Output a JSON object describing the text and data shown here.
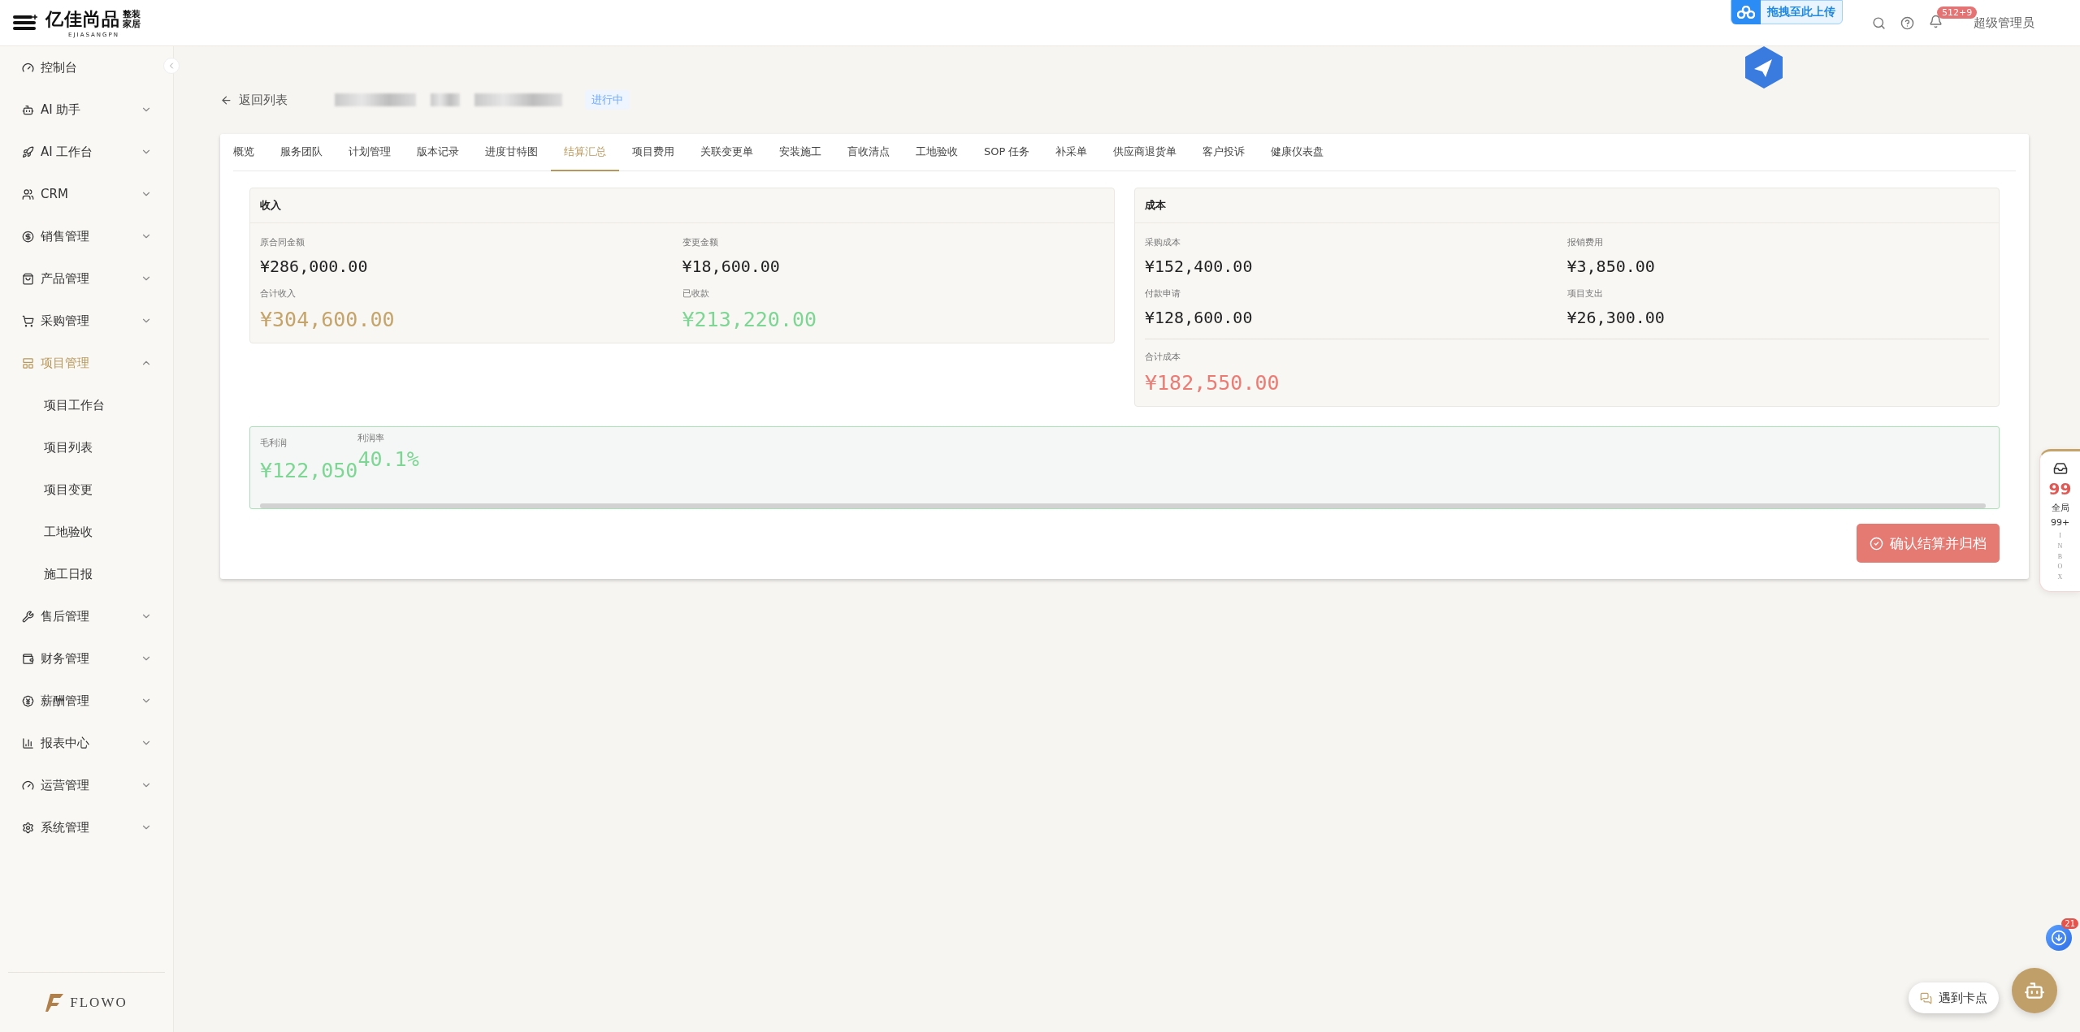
{
  "header": {
    "logo": {
      "name": "亿佳尚品",
      "tag": "整装家居",
      "sub": "EJIASANGPN"
    },
    "upload_hint": "拖拽至此上传",
    "notification_count": "512+9",
    "user": "超级管理员"
  },
  "sidebar": {
    "items": [
      {
        "label": "控制台",
        "selected": false
      },
      {
        "label": "AI 助手",
        "expanded": false,
        "selected": false
      },
      {
        "label": "AI 工作台",
        "expanded": false,
        "selected": false
      },
      {
        "label": "CRM",
        "expanded": false,
        "selected": false
      },
      {
        "label": "销售管理",
        "expanded": false,
        "selected": false
      },
      {
        "label": "产品管理",
        "expanded": false,
        "selected": false
      },
      {
        "label": "采购管理",
        "expanded": false,
        "selected": false
      },
      {
        "label": "项目管理",
        "expanded": true,
        "selected": true,
        "children": [
          {
            "label": "项目工作台",
            "selected": false
          },
          {
            "label": "项目列表",
            "selected": false
          },
          {
            "label": "项目变更",
            "selected": false
          },
          {
            "label": "工地验收",
            "selected": false
          },
          {
            "label": "施工日报",
            "selected": false
          }
        ]
      },
      {
        "label": "售后管理",
        "expanded": false,
        "selected": false
      },
      {
        "label": "财务管理",
        "expanded": false,
        "selected": false
      },
      {
        "label": "薪酬管理",
        "expanded": false,
        "selected": false
      },
      {
        "label": "报表中心",
        "expanded": false,
        "selected": false
      },
      {
        "label": "运营管理",
        "expanded": false,
        "selected": false
      },
      {
        "label": "系统管理",
        "expanded": false,
        "selected": false
      }
    ],
    "footer_logo": "FLOWO"
  },
  "page": {
    "back": "返回列表",
    "status": "进行中",
    "tabs": [
      {
        "label": "概览",
        "selected": false
      },
      {
        "label": "服务团队",
        "selected": false
      },
      {
        "label": "计划管理",
        "selected": false
      },
      {
        "label": "版本记录",
        "selected": false
      },
      {
        "label": "进度甘特图",
        "selected": false
      },
      {
        "label": "结算汇总",
        "selected": true
      },
      {
        "label": "项目费用",
        "selected": false
      },
      {
        "label": "关联变更单",
        "selected": false
      },
      {
        "label": "安装施工",
        "selected": false
      },
      {
        "label": "盲收清点",
        "selected": false
      },
      {
        "label": "工地验收",
        "selected": false
      },
      {
        "label": "SOP 任务",
        "selected": false
      },
      {
        "label": "补采单",
        "selected": false
      },
      {
        "label": "供应商退货单",
        "selected": false
      },
      {
        "label": "客户投诉",
        "selected": false
      },
      {
        "label": "健康仪表盘",
        "selected": false
      }
    ],
    "income": {
      "title": "收入",
      "fields": [
        {
          "label": "原合同金额",
          "value": "¥286,000.00",
          "color": "#222222"
        },
        {
          "label": "变更金额",
          "value": "¥18,600.00",
          "color": "#222222"
        },
        {
          "label": "合计收入",
          "value": "¥304,600.00",
          "color": "#c4a46a"
        },
        {
          "label": "已收款",
          "value": "¥213,220.00",
          "color": "#7ed694"
        }
      ]
    },
    "cost": {
      "title": "成本",
      "fields": [
        {
          "label": "采购成本",
          "value": "¥152,400.00",
          "color": "#222222"
        },
        {
          "label": "报销费用",
          "value": "¥3,850.00",
          "color": "#222222"
        },
        {
          "label": "付款申请",
          "value": "¥128,600.00",
          "color": "#222222"
        },
        {
          "label": "项目支出",
          "value": "¥26,300.00",
          "color": "#222222"
        }
      ],
      "total": {
        "label": "合计成本",
        "value": "¥182,550.00",
        "color": "#ec7b74"
      }
    },
    "profit": [
      {
        "label": "毛利润",
        "value": "¥122,050",
        "color": "#7ed694"
      },
      {
        "label": "利润率",
        "value": "40.1%",
        "color": "#7ed694"
      }
    ],
    "confirm_button": "确认结算并归档"
  },
  "inbox": {
    "count": "99",
    "scope": "全局",
    "scope_count": "99+",
    "label": "INBOX"
  },
  "download_badge": "21",
  "help_button": "遇到卡点"
}
